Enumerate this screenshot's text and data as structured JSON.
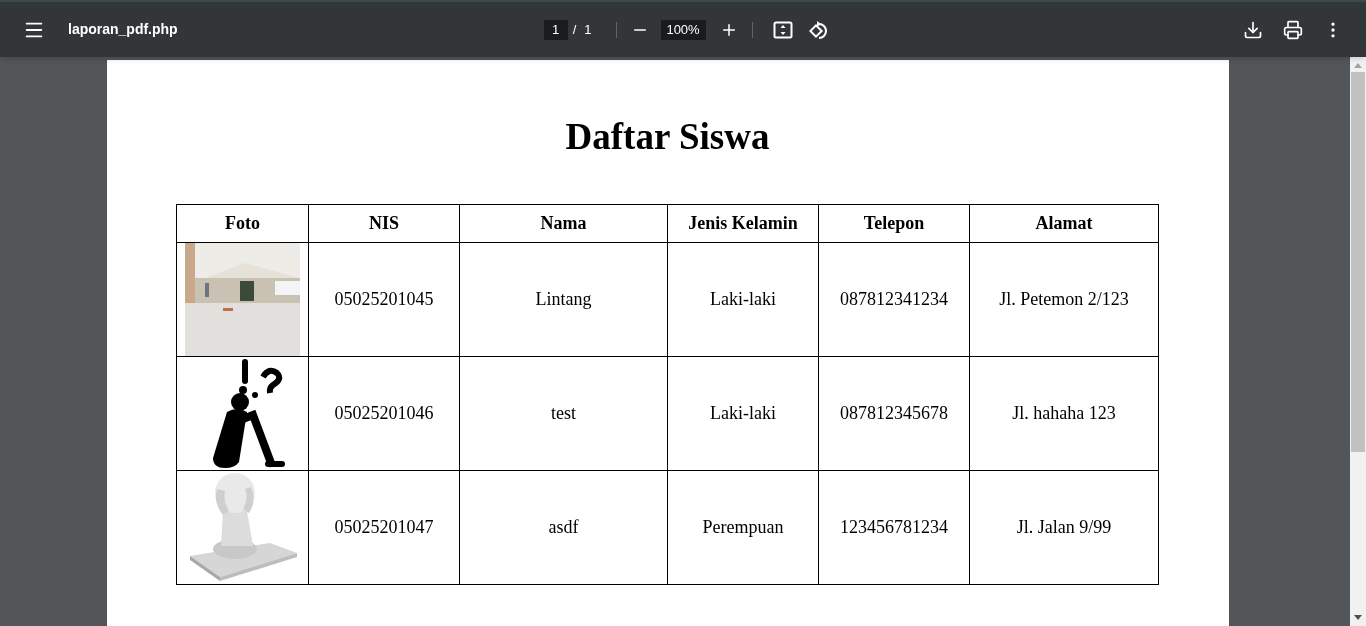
{
  "toolbar": {
    "file_name": "laporan_pdf.php",
    "page": "1",
    "page_separator": "/",
    "page_total": "1",
    "zoom": "100%"
  },
  "document": {
    "title": "Daftar Siswa",
    "table": {
      "columns": [
        "Foto",
        "NIS",
        "Nama",
        "Jenis Kelamin",
        "Telepon",
        "Alamat"
      ],
      "rows": [
        {
          "cells": [
            "",
            "05025201045",
            "Lintang",
            "Laki-laki",
            "087812341234",
            "Jl. Petemon 2/123"
          ]
        },
        {
          "cells": [
            "",
            "05025201046",
            "test",
            "Laki-laki",
            "087812345678",
            "Jl. hahaha 123"
          ]
        },
        {
          "cells": [
            "",
            "05025201047",
            "asdf",
            "Perempuan",
            "123456781234",
            "Jl. Jalan 9/99"
          ]
        }
      ]
    }
  }
}
